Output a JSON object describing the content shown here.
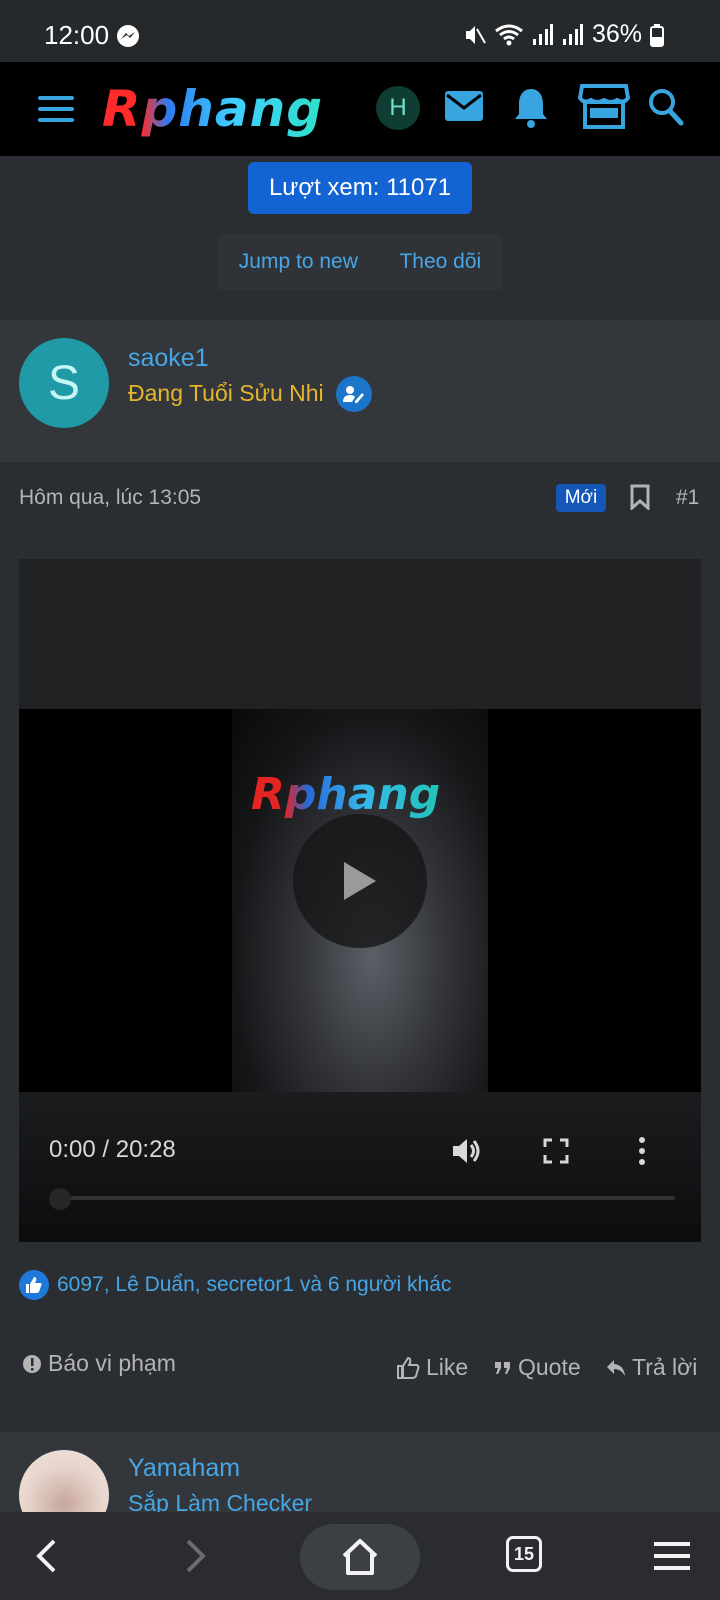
{
  "status_bar": {
    "time": "12:00",
    "battery": "36%",
    "icons": [
      "messenger-icon",
      "mute-icon",
      "wifi-icon",
      "signal-icon",
      "battery-icon"
    ]
  },
  "nav": {
    "logo": "Rphang",
    "avatar_letter": "H",
    "icons": [
      "menu-icon",
      "mail-icon",
      "bell-icon",
      "store-icon",
      "search-icon"
    ],
    "accent": "#38a5e0"
  },
  "thread": {
    "views_label": "Lượt xem: 11071",
    "jump_to_new": "Jump to new",
    "watch": "Theo dõi"
  },
  "post1": {
    "avatar_letter": "S",
    "username": "saoke1",
    "user_title": "Đang Tuổi Sửu Nhi",
    "date": "Hôm qua, lúc 13:05",
    "new_badge": "Mới",
    "post_number": "#1",
    "video": {
      "watermark": "Rphang",
      "time": "0:00 / 20:28"
    },
    "reactions": "6097, Lê Duẩn, secretor1 và 6 người khác",
    "actions": {
      "report": "Báo vi phạm",
      "like": "Like",
      "quote": "Quote",
      "reply": "Trả lời"
    }
  },
  "post2": {
    "username": "Yamaham",
    "user_title": "Sắp Làm Checker"
  },
  "browser": {
    "tab_count": "15"
  }
}
